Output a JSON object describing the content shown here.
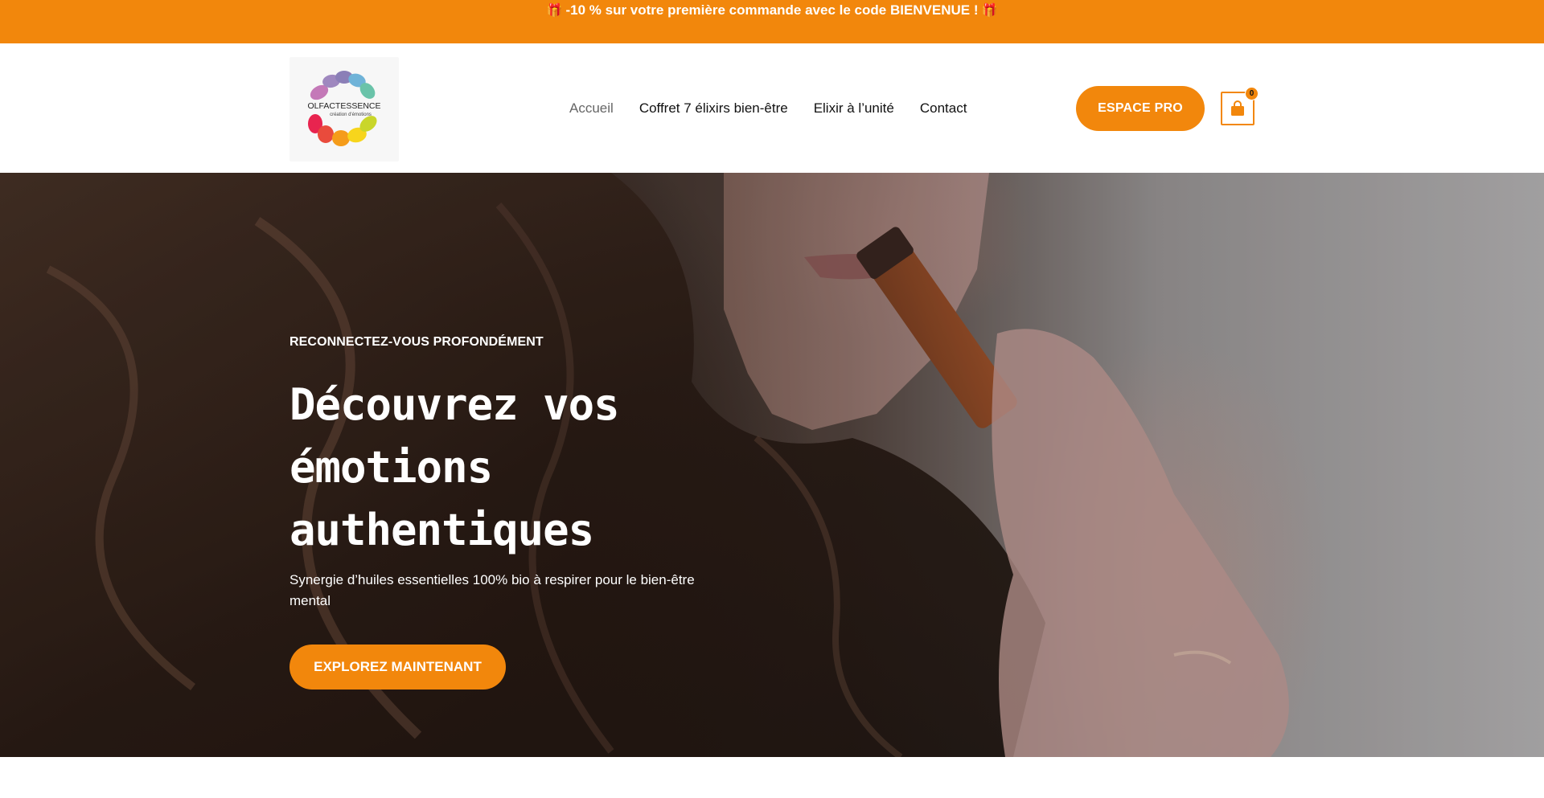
{
  "promo": {
    "text": "-10 % sur votre première commande avec le code BIENVENUE !",
    "gift_icon": "gift-icon"
  },
  "header": {
    "logo": {
      "brand": "OLFACTESSENCE",
      "tagline": "création d'émotions"
    },
    "nav": [
      {
        "label": "Accueil",
        "active": true
      },
      {
        "label": "Coffret 7 élixirs bien-être",
        "active": false
      },
      {
        "label": "Elixir à l’unité",
        "active": false
      },
      {
        "label": "Contact",
        "active": false
      }
    ],
    "pro_button": "ESPACE PRO",
    "cart": {
      "icon": "shopping-bag-icon",
      "count": "0"
    }
  },
  "hero": {
    "eyebrow": "RECONNECTEZ-VOUS PROFONDÉMENT",
    "title_lines": [
      "Découvrez vos",
      "émotions",
      "authentiques"
    ],
    "subtitle": "Synergie d’huiles essentielles 100% bio à respirer pour le bien-être mental",
    "cta": "EXPLOREZ MAINTENANT"
  },
  "colors": {
    "accent": "#f2870c",
    "white": "#ffffff",
    "nav_active": "#666666"
  }
}
